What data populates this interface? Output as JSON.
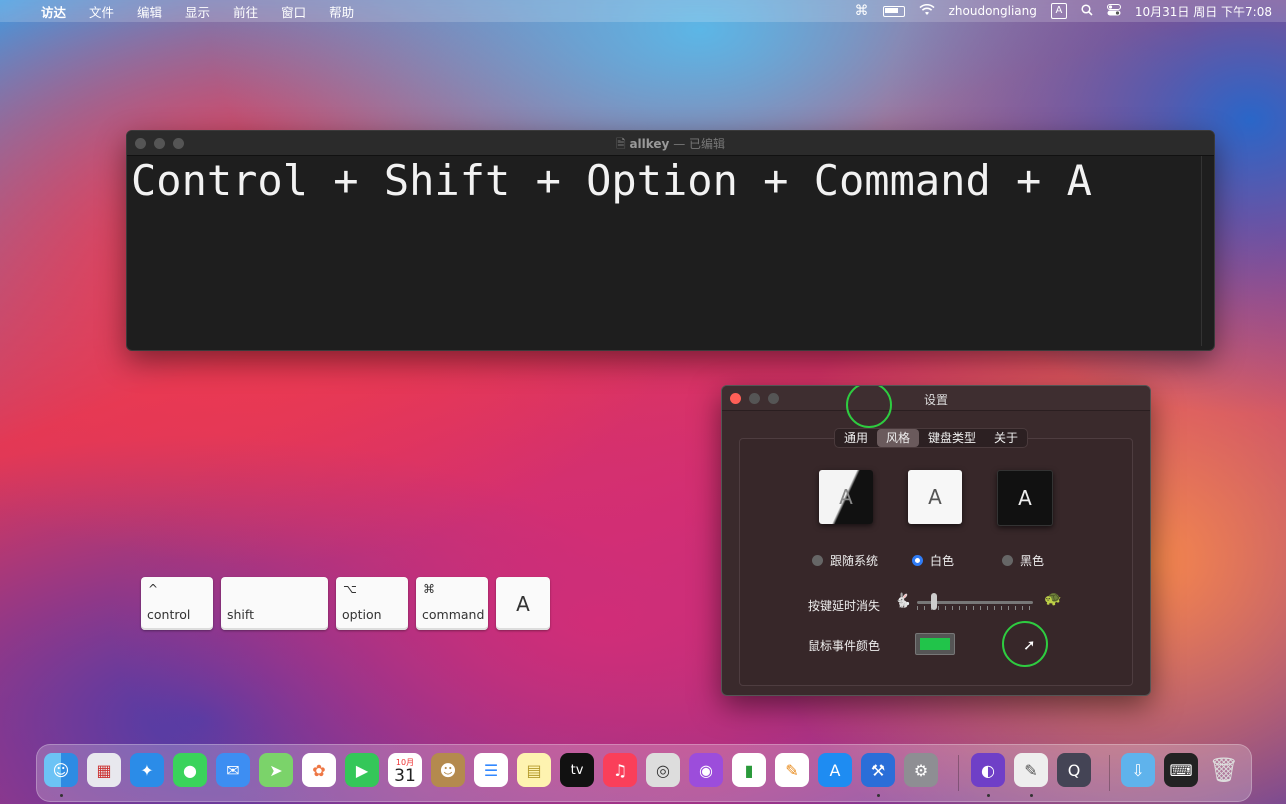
{
  "menubar": {
    "apple": "",
    "items": [
      "访达",
      "文件",
      "编辑",
      "显示",
      "前往",
      "窗口",
      "帮助"
    ],
    "user": "zhoudongliang",
    "ime": "A",
    "datetime": "10月31日 周日 下午7:08"
  },
  "editor": {
    "filename": "allkey",
    "status": "— 已编辑",
    "text": "Control + Shift + Option + Command + A"
  },
  "keys": [
    {
      "symbol": "^",
      "label": "control"
    },
    {
      "symbol": "",
      "label": "shift"
    },
    {
      "symbol": "⌥",
      "label": "option"
    },
    {
      "symbol": "⌘",
      "label": "command"
    },
    {
      "symbol": "",
      "label": "A"
    }
  ],
  "settings": {
    "title": "设置",
    "tabs": [
      "通用",
      "风格",
      "键盘类型",
      "关于"
    ],
    "active_tab": "风格",
    "theme_letter": "A",
    "themes": [
      "跟随系统",
      "白色",
      "黑色"
    ],
    "selected_theme": "白色",
    "delay_label": "按键延时消失",
    "delay_value": 0.15,
    "mouse_color_label": "鼠标事件颜色",
    "mouse_color": "#21c44a"
  },
  "dock": {
    "apps": [
      "finder-icon",
      "launchpad-icon",
      "safari-icon",
      "messages-icon",
      "mail-icon",
      "maps-icon",
      "photos-icon",
      "facetime-icon",
      "calendar-icon",
      "contacts-icon",
      "reminders-icon",
      "notes-icon",
      "appletv-icon",
      "music-icon",
      "screenshot-icon",
      "podcasts-icon",
      "numbers-icon",
      "pages-icon",
      "appstore-icon",
      "xcode-icon",
      "system-preferences-icon",
      "github-desktop-icon",
      "textedit-icon",
      "quicktime-icon",
      "downloads-folder-icon",
      "keycastr-icon",
      "trash-icon"
    ],
    "calendar_month": "10月",
    "calendar_day": "31",
    "tv_label": "tv"
  }
}
